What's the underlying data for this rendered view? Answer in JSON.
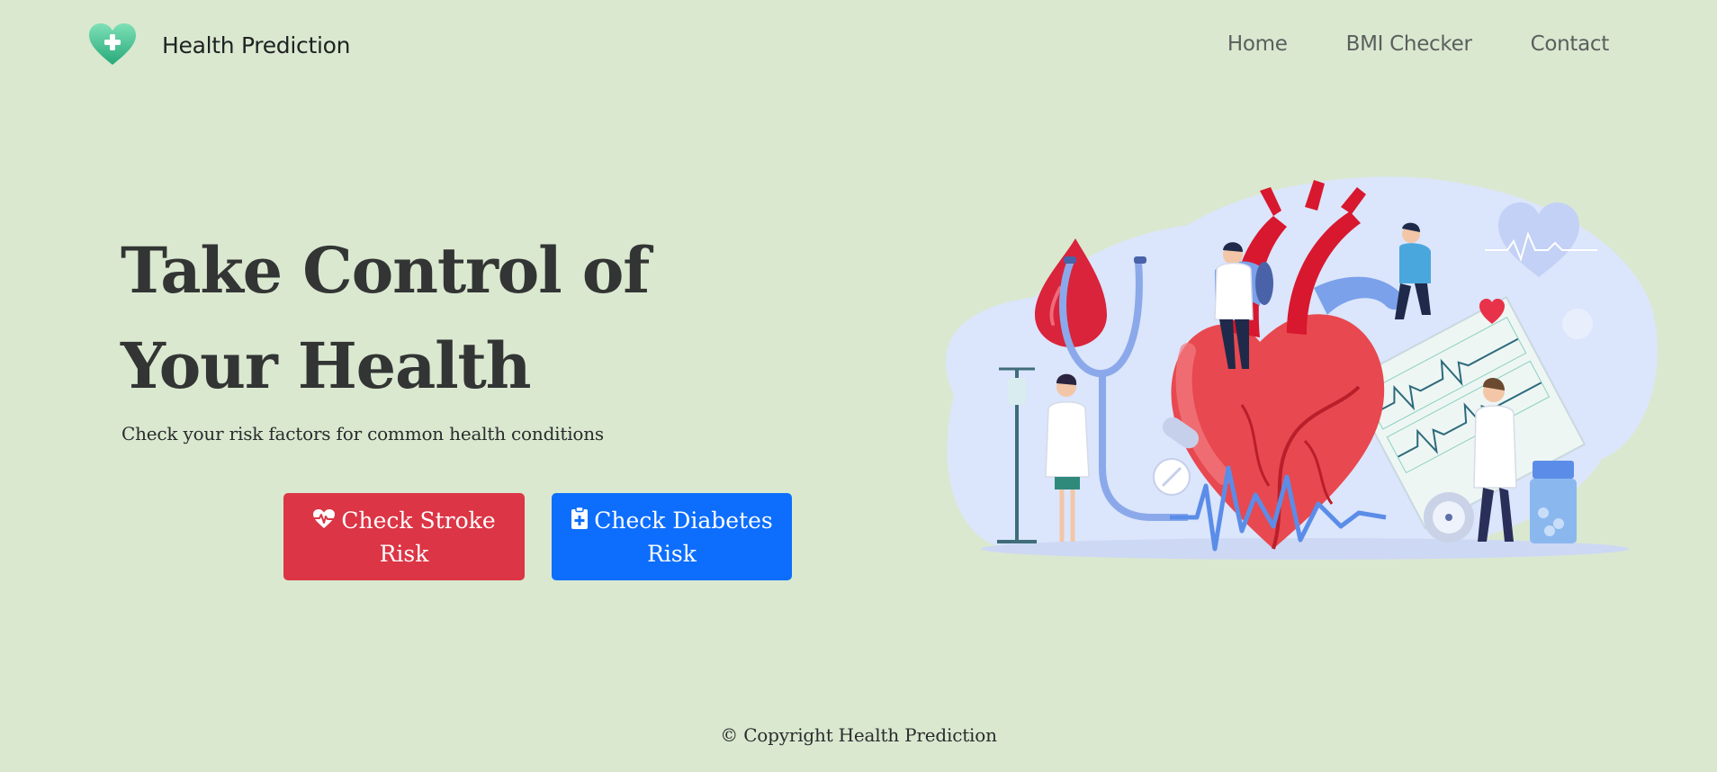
{
  "brand": {
    "name": "Health Prediction",
    "logo_icon": "heart-plus-icon",
    "logo_color": "#3fbf8c"
  },
  "nav": {
    "items": [
      {
        "label": "Home"
      },
      {
        "label": "BMI Checker"
      },
      {
        "label": "Contact"
      }
    ]
  },
  "hero": {
    "title": "Take Control of Your Health",
    "subtitle": "Check your risk factors for common health conditions",
    "buttons": {
      "stroke": {
        "label": "Check Stroke Risk",
        "icon": "heart-pulse-icon",
        "color": "#dc3545"
      },
      "diabetes": {
        "label": "Check Diabetes Risk",
        "icon": "clipboard-plus-icon",
        "color": "#0d6efd"
      }
    },
    "illustration": {
      "subject": "heart-with-doctors-illustration"
    }
  },
  "footer": {
    "copyright_symbol": "©",
    "text": "Copyright Health Prediction"
  },
  "colors": {
    "background": "#dae8d0",
    "text": "#333534"
  }
}
